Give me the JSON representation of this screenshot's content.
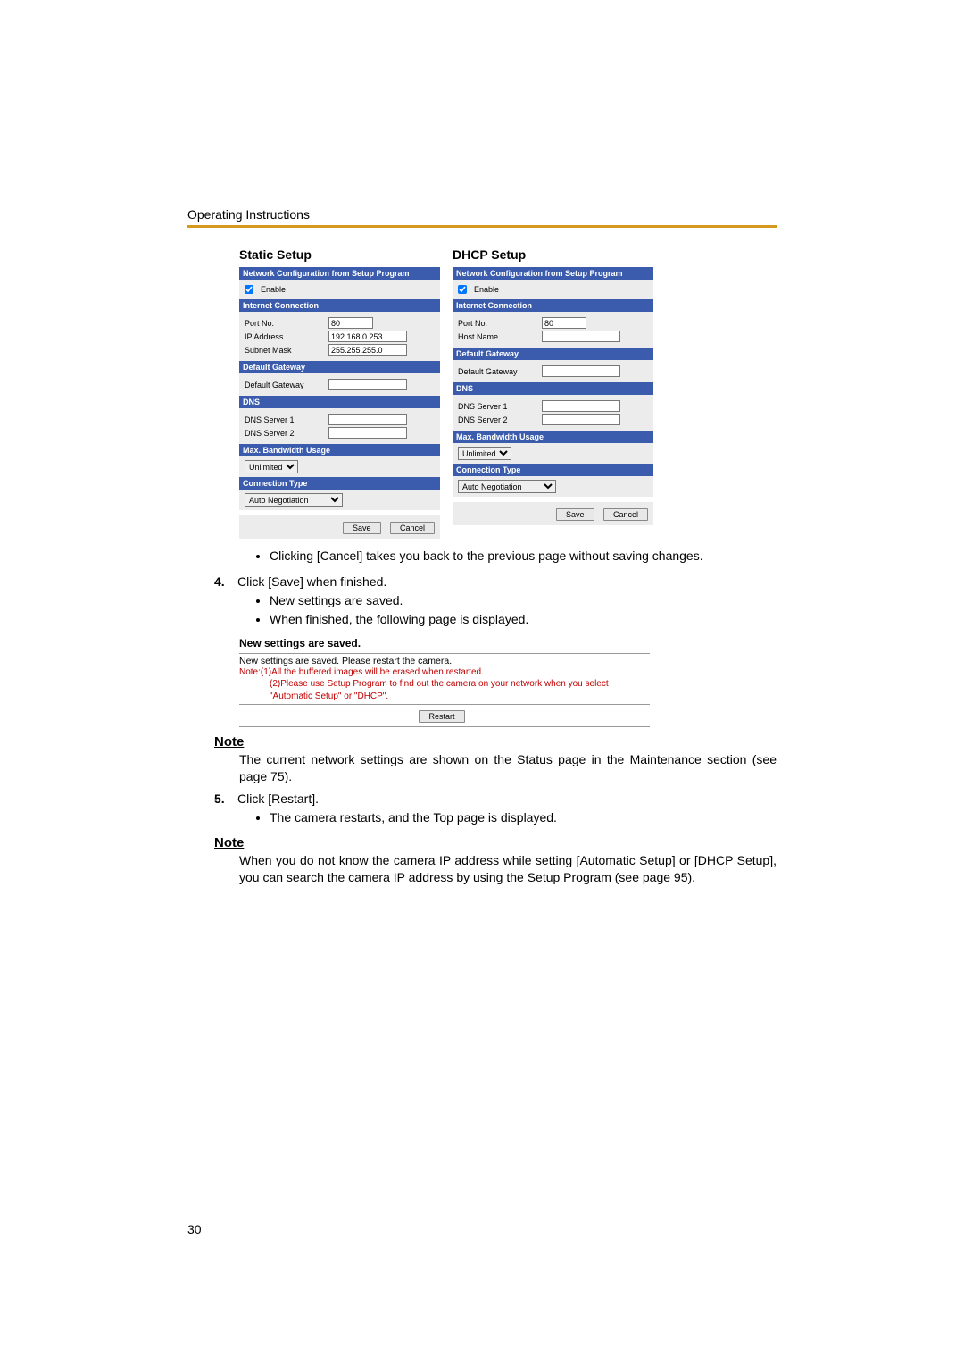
{
  "doc_header": "Operating Instructions",
  "page_number": "30",
  "panels": {
    "static": {
      "title": "Static Setup",
      "hdr_netconf": "Network Configuration from Setup Program",
      "enable": "Enable",
      "hdr_internet": "Internet Connection",
      "portno_lbl": "Port No.",
      "portno_val": "80",
      "ip_lbl": "IP Address",
      "ip_val": "192.168.0.253",
      "mask_lbl": "Subnet Mask",
      "mask_val": "255.255.255.0",
      "hdr_gateway": "Default Gateway",
      "gateway_lbl": "Default Gateway",
      "hdr_dns": "DNS",
      "dns1_lbl": "DNS Server 1",
      "dns2_lbl": "DNS Server 2",
      "hdr_bw": "Max. Bandwidth Usage",
      "bw_opt": "Unlimited",
      "hdr_conn": "Connection Type",
      "conn_opt": "Auto Negotiation",
      "save": "Save",
      "cancel": "Cancel"
    },
    "dhcp": {
      "title": "DHCP Setup",
      "hdr_netconf": "Network Configuration from Setup Program",
      "enable": "Enable",
      "hdr_internet": "Internet Connection",
      "portno_lbl": "Port No.",
      "portno_val": "80",
      "host_lbl": "Host Name",
      "hdr_gateway": "Default Gateway",
      "gateway_lbl": "Default Gateway",
      "hdr_dns": "DNS",
      "dns1_lbl": "DNS Server 1",
      "dns2_lbl": "DNS Server 2",
      "hdr_bw": "Max. Bandwidth Usage",
      "bw_opt": "Unlimited",
      "hdr_conn": "Connection Type",
      "conn_opt": "Auto Negotiation",
      "save": "Save",
      "cancel": "Cancel"
    }
  },
  "bullet_cancel": "Clicking [Cancel] takes you back to the previous page without saving changes.",
  "step4_no": "4.",
  "step4_text": "Click [Save] when finished.",
  "step4_b1": "New settings are saved.",
  "step4_b2": "When finished, the following page is displayed.",
  "saved": {
    "title": "New settings are saved.",
    "line1": "New settings are saved. Please restart the camera.",
    "red1": "Note:(1)All the buffered images will be erased when restarted.",
    "red2": "(2)Please use Setup Program to find out the camera on your network when you select \"Automatic Setup\" or \"DHCP\".",
    "restart": "Restart"
  },
  "note1_hdr": "Note",
  "note1_text": "The current network settings are shown on the Status page in the Maintenance section (see page 75).",
  "step5_no": "5.",
  "step5_text": "Click [Restart].",
  "step5_b1": "The camera restarts, and the Top page is displayed.",
  "note2_hdr": "Note",
  "note2_text": "When you do not know the camera IP address while setting [Automatic Setup] or [DHCP Setup], you can search the camera IP address by using the Setup Program (see page 95)."
}
